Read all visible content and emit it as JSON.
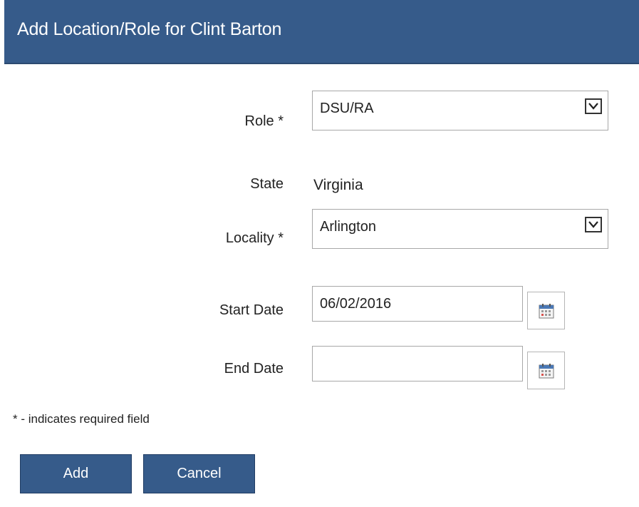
{
  "header": {
    "title": "Add Location/Role for Clint Barton"
  },
  "form": {
    "role": {
      "label": "Role *",
      "value": "DSU/RA",
      "arrow_icon": "chevron-down-icon"
    },
    "state": {
      "label": "State",
      "value": "Virginia"
    },
    "locality": {
      "label": "Locality *",
      "value": "Arlington",
      "arrow_icon": "chevron-down-icon"
    },
    "start_date": {
      "label": "Start Date",
      "value": "06/02/2016",
      "calendar_icon": "calendar-icon"
    },
    "end_date": {
      "label": "End Date",
      "value": "",
      "calendar_icon": "calendar-icon"
    },
    "required_note": "* - indicates required field"
  },
  "actions": {
    "add_label": "Add",
    "cancel_label": "Cancel"
  },
  "colors": {
    "header_bg": "#365b8a",
    "button_bg": "#365b8a",
    "text": "#222222"
  }
}
